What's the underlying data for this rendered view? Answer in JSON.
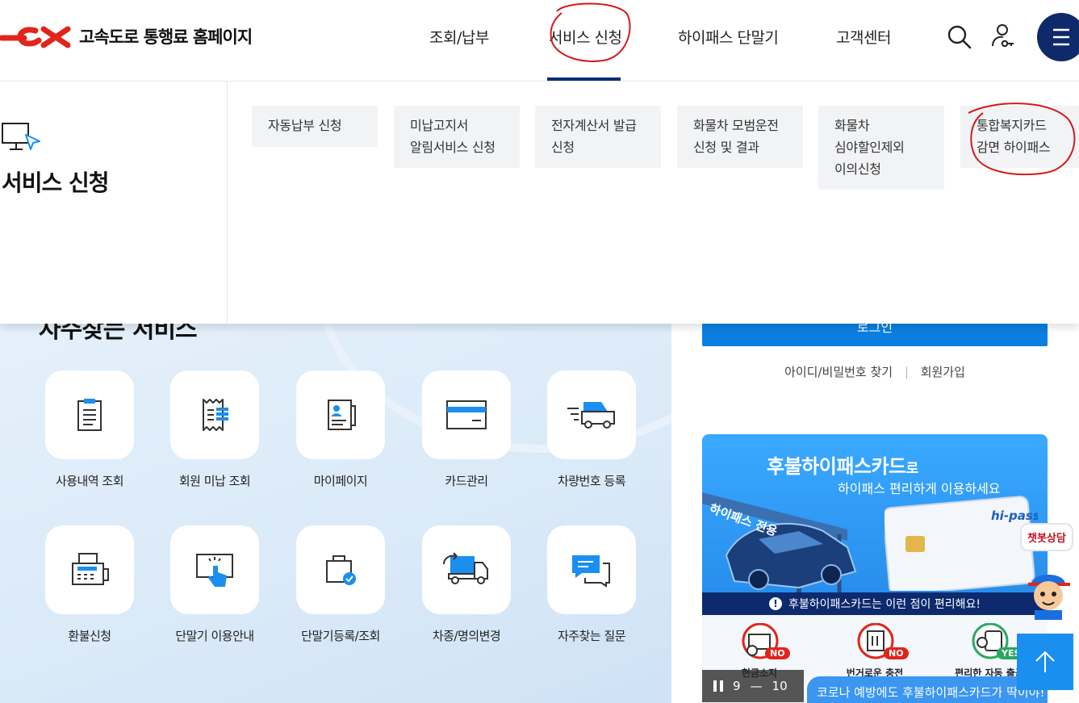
{
  "header": {
    "site_title": "고속도로 통행료 홈페이지",
    "nav": [
      "조회/납부",
      "서비스 신청",
      "하이패스 단말기",
      "고객센터"
    ],
    "active_nav": "서비스 신청",
    "icons": [
      "search-icon",
      "user-key-icon",
      "menu-icon"
    ]
  },
  "mega_menu": {
    "title": "서비스 신청",
    "items": [
      "자동납부 신청",
      "미납고지서\n알림서비스 신청",
      "전자계산서 발급\n신청",
      "화물차 모범운전\n신청 및 결과",
      "화물차\n심야할인제외\n이의신청",
      "통합복지카드\n감면 하이패스"
    ]
  },
  "services": {
    "title": "자주찾는 서비스",
    "items": [
      {
        "label": "사용내역 조회",
        "icon": "clipboard-list-icon"
      },
      {
        "label": "회원 미납 조회",
        "icon": "receipt-icon"
      },
      {
        "label": "마이페이지",
        "icon": "profile-doc-icon"
      },
      {
        "label": "카드관리",
        "icon": "card-icon"
      },
      {
        "label": "차량번호 등록",
        "icon": "car-icon"
      },
      {
        "label": "환불신청",
        "icon": "fax-icon"
      },
      {
        "label": "단말기 이용안내",
        "icon": "touch-icon"
      },
      {
        "label": "단말기등록/조회",
        "icon": "device-check-icon"
      },
      {
        "label": "차종/명의변경",
        "icon": "truck-change-icon"
      },
      {
        "label": "자주찾는 질문",
        "icon": "chat-icon"
      }
    ]
  },
  "account": {
    "login_label": "로그인",
    "find_label": "아이디/비밀번호 찾기",
    "join_label": "회원가입"
  },
  "banner": {
    "title_main": "후불하이패스카드",
    "title_suffix": "로",
    "subtitle": "하이패스 편리하게 이용하세요",
    "road_sign": "하이패스 전용",
    "card_brand": "hi-pass",
    "strip": "후불하이패스카드는 이런 점이 편리해요!",
    "features": [
      {
        "label": "현금소지",
        "badge": "NO"
      },
      {
        "label": "번거로운 충전",
        "badge": "NO"
      },
      {
        "label": "편리한 자동 출금",
        "badge": "YES"
      }
    ],
    "slide_current": "9",
    "slide_total": "10",
    "slide_separator": "—",
    "ticker": "코로나 예방에도 후불하이패스카드가 딱이야!"
  },
  "chatbot": {
    "label": "챗봇상담"
  },
  "colors": {
    "brand_red": "#e1251b",
    "navy": "#0f2a6b",
    "primary_blue": "#0a7fe0"
  }
}
